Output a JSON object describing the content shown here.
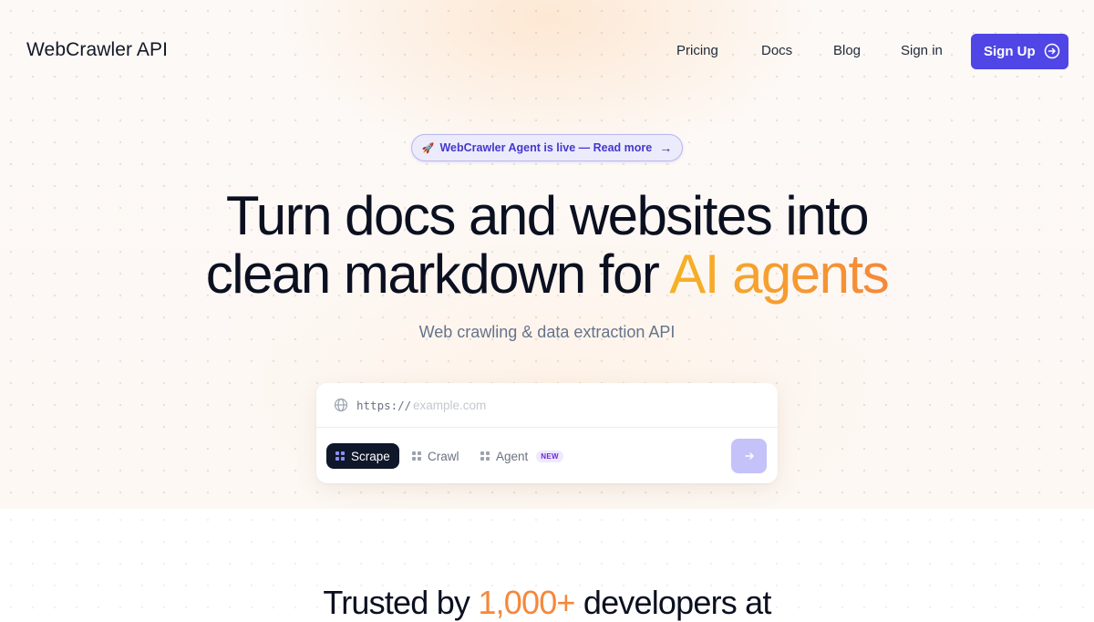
{
  "nav": {
    "brand": "WebCrawler API",
    "links": [
      "Pricing",
      "Docs",
      "Blog",
      "Sign in"
    ],
    "signup_label": "Sign Up",
    "signup_icon": "arrow-circle-right-icon"
  },
  "announcement": {
    "icon": "rocket-icon",
    "text": "WebCrawler Agent is live — Read more",
    "arrow": "→"
  },
  "hero": {
    "headline_line1": "Turn docs and websites into",
    "headline_line2_prefix": "clean markdown for ",
    "headline_line2_accent": "AI agents",
    "subheadline": "Web crawling & data extraction API"
  },
  "search": {
    "prefix": "https://",
    "placeholder": "example.com",
    "modes": [
      {
        "label": "Scrape",
        "active": true
      },
      {
        "label": "Crawl",
        "active": false
      },
      {
        "label": "Agent",
        "active": false,
        "badge": "NEW"
      }
    ],
    "submit_icon": "arrow-right-icon"
  },
  "trusted": {
    "prefix": "Trusted by ",
    "count": "1,000+",
    "suffix": " developers at"
  },
  "colors": {
    "primary": "#4f46e5",
    "accent_start": "#f5b226",
    "accent_end": "#f5883a",
    "dark": "#0f172a"
  }
}
